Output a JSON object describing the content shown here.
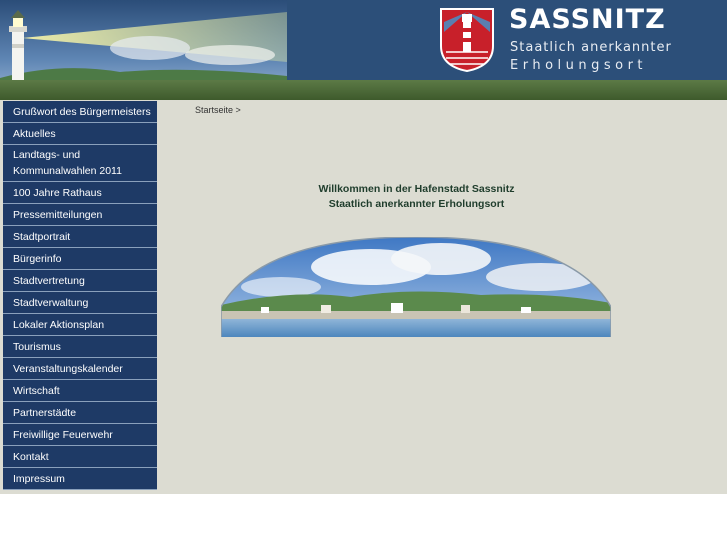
{
  "header": {
    "logo_title": "SASSNITZ",
    "logo_subtitle_1": "Staatlich anerkannter",
    "logo_subtitle_2": "Erholungsort",
    "background_color": "#2c4f79",
    "accent_green": "#4a6a36"
  },
  "nav": {
    "items": [
      {
        "label": "Grußwort des Bürgermeisters"
      },
      {
        "label": "Aktuelles"
      },
      {
        "label": "Landtags- und Kommunalwahlen 2011"
      },
      {
        "label": "100 Jahre Rathaus"
      },
      {
        "label": "Pressemitteilungen"
      },
      {
        "label": "Stadtportrait"
      },
      {
        "label": "Bürgerinfo"
      },
      {
        "label": "Stadtvertretung"
      },
      {
        "label": "Stadtverwaltung"
      },
      {
        "label": "Lokaler Aktionsplan"
      },
      {
        "label": "Tourismus"
      },
      {
        "label": "Veranstaltungskalender"
      },
      {
        "label": "Wirtschaft"
      },
      {
        "label": "Partnerstädte"
      },
      {
        "label": "Freiwillige Feuerwehr"
      },
      {
        "label": "Kontakt"
      },
      {
        "label": "Impressum"
      }
    ]
  },
  "breadcrumb": "Startseite >",
  "welcome": {
    "line1": "Willkommen in der Hafenstadt Sassnitz",
    "line2": "Staatlich anerkannter Erholungsort"
  }
}
